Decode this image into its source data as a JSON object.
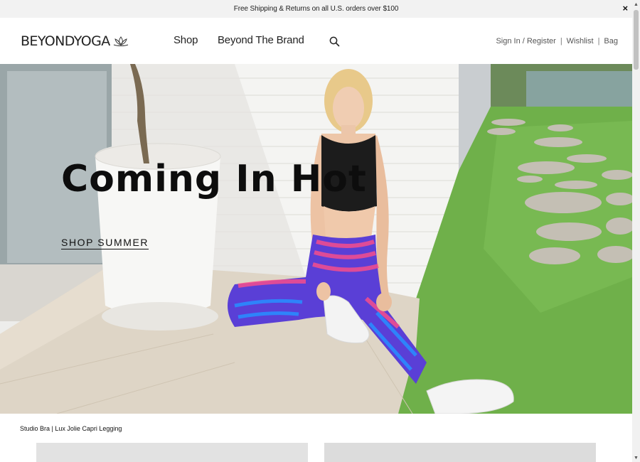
{
  "promo": {
    "text": "Free Shipping & Returns on all U.S. orders over $100",
    "close": "×"
  },
  "header": {
    "logo_bold": "BEYOND",
    "logo_thin": "YOGA",
    "nav": [
      {
        "label": "Shop"
      },
      {
        "label": "Beyond The Brand"
      }
    ],
    "sign_in": "Sign In / Register",
    "wishlist": "Wishlist",
    "bag": "Bag",
    "separator": "|"
  },
  "hero": {
    "title": "Coming In Hot",
    "cta": "SHOP SUMMER"
  },
  "caption": "Studio Bra | Lux Jolie Capri Legging",
  "scrollbar": {
    "up": "▲",
    "down": "▼"
  },
  "colors": {
    "brand_text": "#222222",
    "promo_bg": "#f2f2f2",
    "hero_title": "#0d0d0d"
  }
}
